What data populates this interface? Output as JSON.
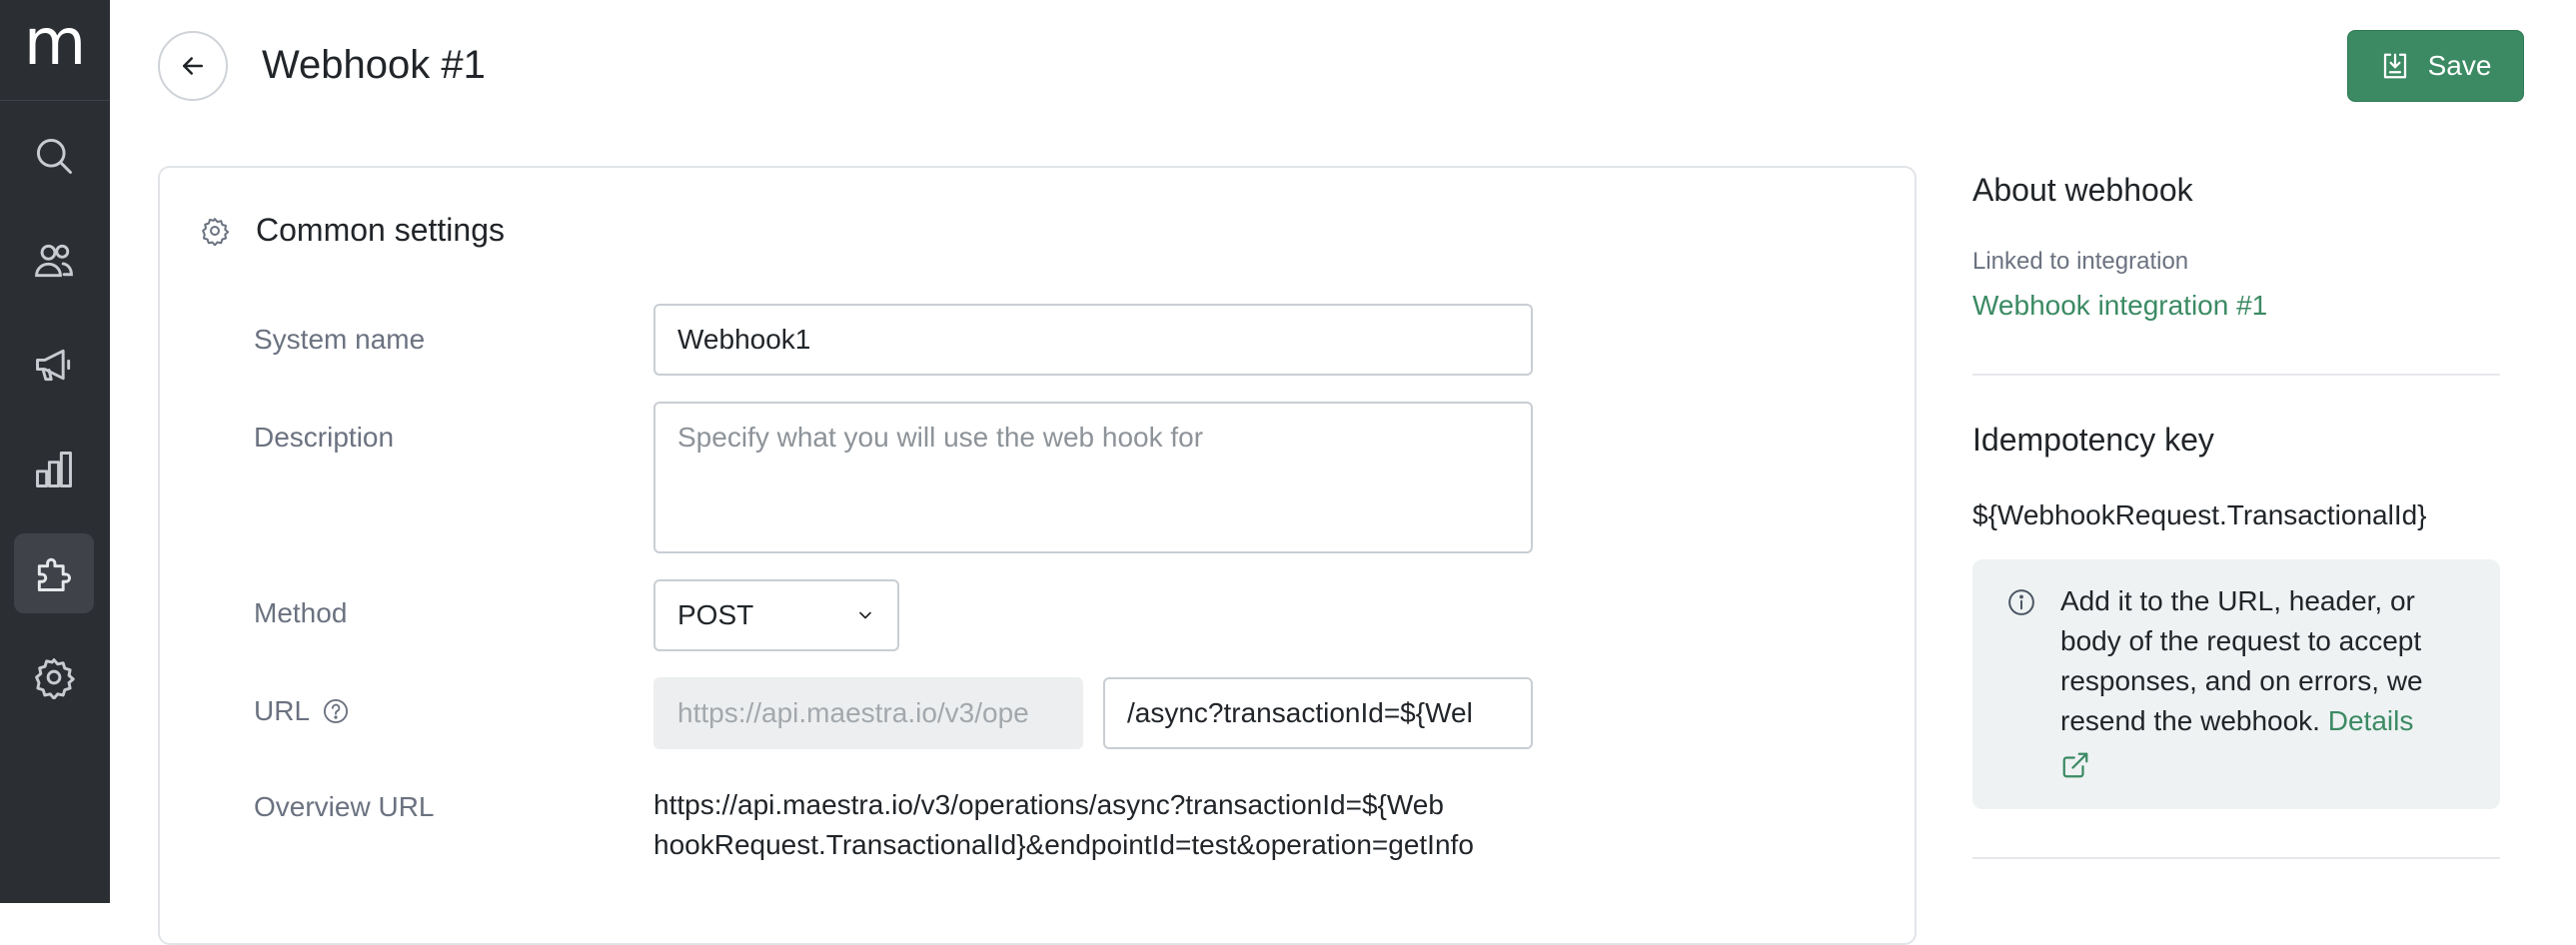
{
  "app": {
    "logo_letter": "m"
  },
  "sidebar": {
    "items": [
      {
        "icon": "search-icon"
      },
      {
        "icon": "users-icon"
      },
      {
        "icon": "megaphone-icon"
      },
      {
        "icon": "analytics-icon"
      },
      {
        "icon": "puzzle-icon",
        "active": true
      },
      {
        "icon": "gear-icon"
      }
    ]
  },
  "header": {
    "title": "Webhook #1",
    "save_label": "Save"
  },
  "common_settings": {
    "title": "Common settings",
    "system_name": {
      "label": "System name",
      "value": "Webhook1"
    },
    "description": {
      "label": "Description",
      "placeholder": "Specify what you will use the web hook for"
    },
    "method": {
      "label": "Method",
      "value": "POST"
    },
    "url": {
      "label": "URL",
      "base": "https://api.maestra.io/v3/ope",
      "path": "/async?transactionId=${Wel"
    },
    "overview_url": {
      "label": "Overview URL",
      "line1": "https://api.maestra.io/v3/operations/async?transactionId=${Web",
      "line2": "hookRequest.TransactionalId}&endpointId=test&operation=getInfo"
    }
  },
  "about": {
    "title": "About webhook",
    "linked_label": "Linked to integration",
    "linked_value": "Webhook integration #1"
  },
  "idempotency": {
    "title": "Idempotency key",
    "key": "${WebhookRequest.TransactionalId}",
    "info": "Add it to the URL, header, or body of the request to accept responses, and on errors, we resend the webhook.",
    "details_link": "Details"
  },
  "colors": {
    "sidebar_bg": "#2b2e33",
    "accent": "#3b8a63"
  }
}
